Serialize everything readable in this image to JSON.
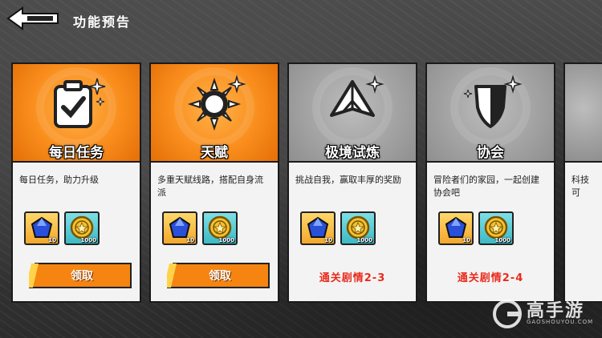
{
  "header": {
    "title": "功能预告"
  },
  "cards": [
    {
      "title": "每日任务",
      "icon": "daily-task-clipboard-icon",
      "theme": "orange",
      "description": "每日任务，助力升级",
      "rewards": [
        {
          "name": "gem-icon",
          "count": "10"
        },
        {
          "name": "coin-icon",
          "count": "1000"
        }
      ],
      "claim_label": "领取"
    },
    {
      "title": "天赋",
      "icon": "talent-gear-sun-icon",
      "theme": "orange",
      "description": "多重天赋线路，搭配自身流派",
      "rewards": [
        {
          "name": "gem-icon",
          "count": "10"
        },
        {
          "name": "coin-icon",
          "count": "1000"
        }
      ],
      "claim_label": "领取"
    },
    {
      "title": "极境试炼",
      "icon": "trial-paper-plane-icon",
      "theme": "gray",
      "description": "挑战自我，赢取丰厚的奖励",
      "rewards": [
        {
          "name": "gem-icon",
          "count": "10"
        },
        {
          "name": "coin-icon",
          "count": "1000"
        }
      ],
      "unlock_text": "通关剧情2-3"
    },
    {
      "title": "协会",
      "icon": "guild-shield-icon",
      "theme": "gray",
      "description": "冒险者们的家园，一起创建协会吧",
      "rewards": [
        {
          "name": "gem-icon",
          "count": "10"
        },
        {
          "name": "coin-icon",
          "count": "1000"
        }
      ],
      "unlock_text": "通关剧情2-4"
    },
    {
      "title": "",
      "theme": "gray",
      "description": "科技可"
    }
  ],
  "watermark": {
    "text": "高手游",
    "sub": "GAOSHOUYOU.COM"
  },
  "colors": {
    "orange": "#f98d1c",
    "gray": "#a3a3a3",
    "lock_red": "#e82a1c"
  }
}
